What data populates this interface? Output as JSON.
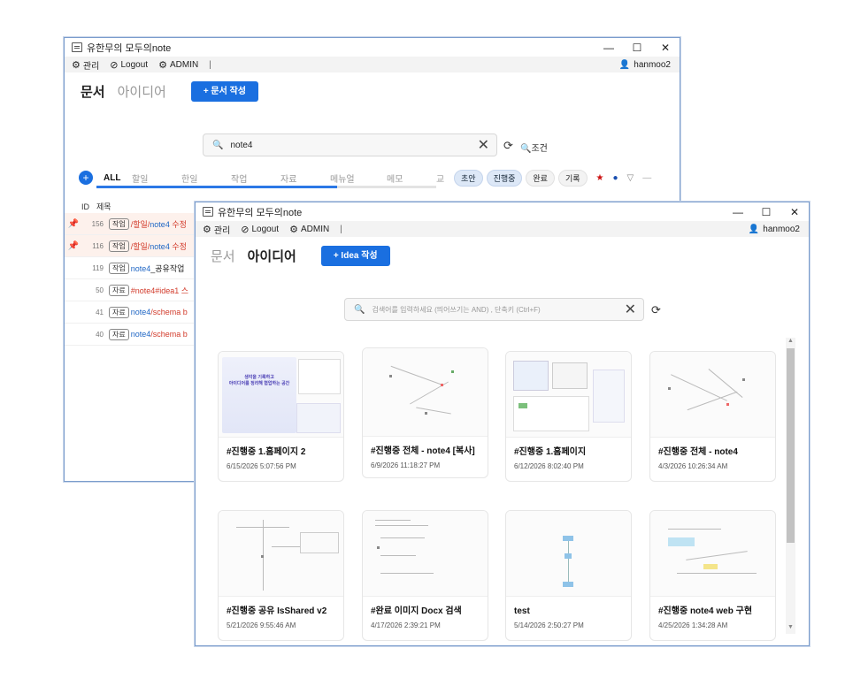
{
  "window_back": {
    "title": "유한무의 모두의note",
    "menu": {
      "manage": "관리",
      "logout": "Logout",
      "admin": "ADMIN",
      "separator": "|",
      "user": "hanmoo2"
    },
    "modes": {
      "doc": "문서",
      "idea": "아이디어"
    },
    "new_doc_button": "+ 문서 작성",
    "search_value": "note4",
    "condition_label": "조건",
    "tabs": [
      "ALL",
      "할일",
      "한일",
      "작업",
      "자료",
      "메뉴얼",
      "메모",
      "교"
    ],
    "status_pills": [
      "초안",
      "진행중",
      "완료",
      "기록"
    ],
    "table_headers": {
      "id": "ID",
      "title": "제목"
    },
    "rows": [
      {
        "id": "156",
        "badge": "작업",
        "pinned": true,
        "parts": [
          "/할일/",
          "note4",
          " 수정"
        ]
      },
      {
        "id": "116",
        "badge": "작업",
        "pinned": true,
        "parts": [
          "/할일/",
          "note4",
          " 수정"
        ]
      },
      {
        "id": "119",
        "badge": "작업",
        "pinned": false,
        "parts": [
          "",
          "note4",
          "_공유작업"
        ]
      },
      {
        "id": "50",
        "badge": "자료",
        "pinned": false,
        "parts": [
          "#",
          "note4",
          "#idea1 스"
        ]
      },
      {
        "id": "41",
        "badge": "자료",
        "pinned": false,
        "parts": [
          "",
          "note4",
          "/schema b"
        ]
      },
      {
        "id": "40",
        "badge": "자료",
        "pinned": false,
        "parts": [
          "",
          "note4",
          "/schema b"
        ]
      }
    ]
  },
  "window_front": {
    "title": "유한무의 모두의note",
    "menu": {
      "manage": "관리",
      "logout": "Logout",
      "admin": "ADMIN",
      "separator": "|",
      "user": "hanmoo2"
    },
    "modes": {
      "doc": "문서",
      "idea": "아이디어"
    },
    "new_idea_button": "+ Idea 작성",
    "search_placeholder": "검색어를 입력하세요 (띄어쓰기는 AND) , 단축키 (Ctrl+F)",
    "cards": [
      {
        "title": "#진행중 1.홈페이지 2",
        "date": "6/15/2026 5:07:56 PM"
      },
      {
        "title": "#진행중 전체 - note4 [복사]",
        "date": "6/9/2026 11:18:27 PM"
      },
      {
        "title": "#진행중 1.홈페이지",
        "date": "6/12/2026 8:02:40 PM"
      },
      {
        "title": "#진행중 전체 - note4",
        "date": "4/3/2026 10:26:34 AM"
      },
      {
        "title": "#진행중 공유 IsShared v2",
        "date": "5/21/2026 9:55:46 AM"
      },
      {
        "title": "#완료 이미지 Docx 검색",
        "date": "4/17/2026 2:39:21 PM"
      },
      {
        "title": "test",
        "date": "5/14/2026 2:50:27 PM"
      },
      {
        "title": "#진행중 note4 web 구현",
        "date": "4/25/2026 1:34:28 AM"
      }
    ],
    "thumb_banner": {
      "line1": "생각을 기록하고",
      "line2": "아이디어를 정리해 협업하는 공간"
    }
  },
  "colors": {
    "accent": "#1a6fe0",
    "tag_red": "#d23a2a",
    "tag_blue": "#1f66c4",
    "pin": "#dd2222"
  }
}
